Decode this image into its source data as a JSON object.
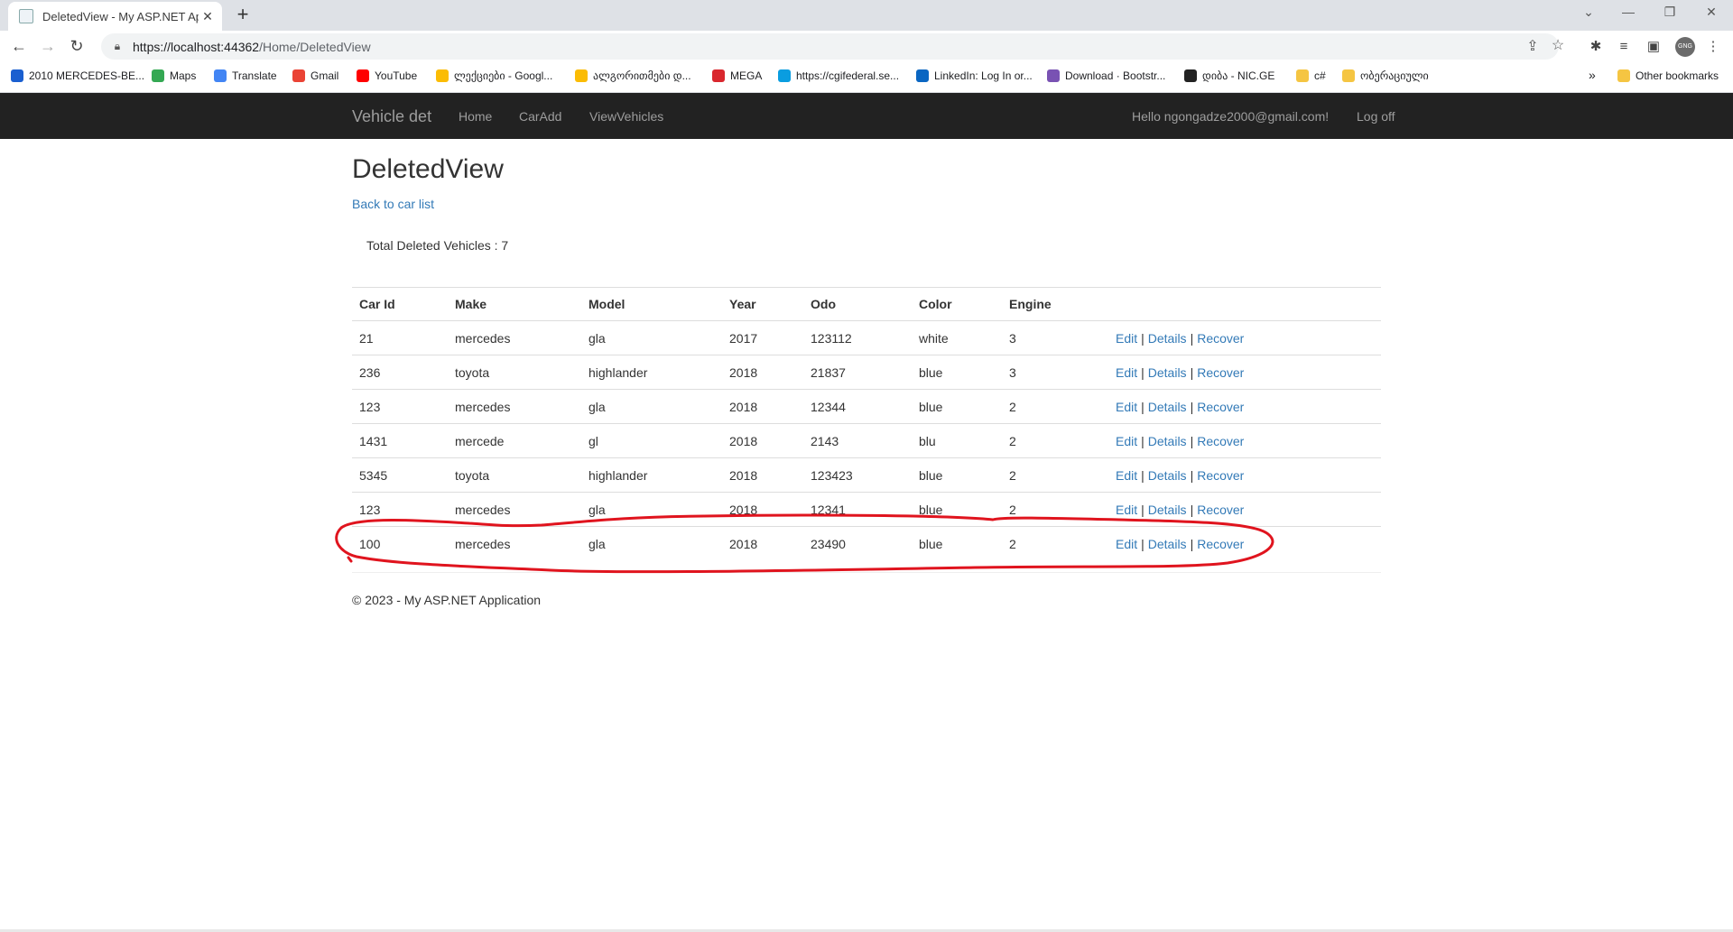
{
  "browser": {
    "tab_title": "DeletedView - My ASP.NET Appli",
    "url_host": "https://localhost:44362",
    "url_path": "/Home/DeletedView",
    "bookmarks": [
      {
        "label": "2010 MERCEDES-BE...",
        "icon": "c-logo-icon",
        "color": "#1a5fd0"
      },
      {
        "label": "Maps",
        "icon": "maps-pin-icon",
        "color": "#34a853"
      },
      {
        "label": "Translate",
        "icon": "translate-icon",
        "color": "#4285f4"
      },
      {
        "label": "Gmail",
        "icon": "gmail-icon",
        "color": "#ea4335"
      },
      {
        "label": "YouTube",
        "icon": "youtube-icon",
        "color": "#ff0000"
      },
      {
        "label": "ლექციები - Googl...",
        "icon": "drive-icon",
        "color": "#fbbc04"
      },
      {
        "label": "ალგორითმები დ...",
        "icon": "drive-icon",
        "color": "#fbbc04"
      },
      {
        "label": "MEGA",
        "icon": "mega-icon",
        "color": "#d9272e"
      },
      {
        "label": "https://cgifederal.se...",
        "icon": "cloud-icon",
        "color": "#0a9de0"
      },
      {
        "label": "LinkedIn: Log In or...",
        "icon": "linkedin-icon",
        "color": "#0a66c2"
      },
      {
        "label": "Download · Bootstr...",
        "icon": "bootstrap-icon",
        "color": "#7952b3"
      },
      {
        "label": "დიბა - NIC.GE",
        "icon": "ge-icon",
        "color": "#222222"
      },
      {
        "label": "c#",
        "icon": "folder-icon",
        "color": "#f5c542"
      },
      {
        "label": "ობერაციული",
        "icon": "folder-icon",
        "color": "#f5c542"
      }
    ],
    "overflow": "»",
    "other_bookmarks": "Other bookmarks",
    "profile_initials": "GNG"
  },
  "nav": {
    "brand": "Vehicle det",
    "links": [
      "Home",
      "CarAdd",
      "ViewVehicles"
    ],
    "greeting": "Hello ngongadze2000@gmail.com!",
    "logoff": "Log off"
  },
  "page": {
    "title": "DeletedView",
    "back_link": "Back to car list",
    "total_text": "Total Deleted Vehicles : 7"
  },
  "table": {
    "headers": [
      "Car Id",
      "Make",
      "Model",
      "Year",
      "Odo",
      "Color",
      "Engine"
    ],
    "rows": [
      [
        "21",
        "mercedes",
        "gla",
        "2017",
        "123112",
        "white",
        "3"
      ],
      [
        "236",
        "toyota",
        "highlander",
        "2018",
        "21837",
        "blue",
        "3"
      ],
      [
        "123",
        "mercedes",
        "gla",
        "2018",
        "12344",
        "blue",
        "2"
      ],
      [
        "1431",
        "mercede",
        "gl",
        "2018",
        "2143",
        "blu",
        "2"
      ],
      [
        "5345",
        "toyota",
        "highlander",
        "2018",
        "123423",
        "blue",
        "2"
      ],
      [
        "123",
        "mercedes",
        "gla",
        "2018",
        "12341",
        "blue",
        "2"
      ],
      [
        "100",
        "mercedes",
        "gla",
        "2018",
        "23490",
        "blue",
        "2"
      ]
    ],
    "actions": {
      "edit": "Edit",
      "details": "Details",
      "recover": "Recover",
      "sep": "|"
    }
  },
  "footer": "© 2023 - My ASP.NET Application",
  "annotation_color": "#e0141e"
}
